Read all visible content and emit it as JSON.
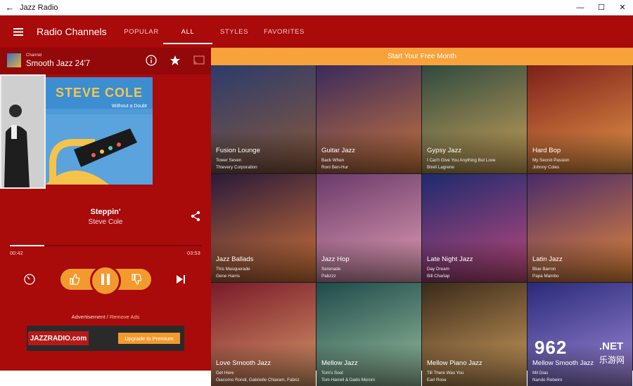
{
  "window": {
    "title": "Jazz Radio",
    "back_glyph": "←",
    "minimize_glyph": "—",
    "maximize_glyph": "☐",
    "close_glyph": "✕"
  },
  "header": {
    "title": "Radio Channels",
    "tabs": [
      {
        "label": "POPULAR",
        "active": false
      },
      {
        "label": "ALL",
        "active": true
      },
      {
        "label": "STYLES",
        "active": false
      },
      {
        "label": "FAVORITES",
        "active": false
      }
    ]
  },
  "player": {
    "channel_caption": "Channel",
    "channel_name": "Smooth Jazz 24'7",
    "album_artist": "STEVE COLE",
    "album_subtitle": "Without a Doubt",
    "song": "Steppin'",
    "artist": "Steve Cole",
    "elapsed": "00:42",
    "duration": "03:53",
    "progress": 0.18
  },
  "ad": {
    "label": "Advertisement",
    "separator": "/",
    "remove_label": "Remove Ads",
    "banner_logo": "JAZZRADIO.com",
    "banner_button": "Upgrade to Premium"
  },
  "promo": "Start Your Free Month",
  "channels": [
    {
      "name": "Fusion Lounge",
      "song": "Tower Seven",
      "artist": "Thievery Corporation",
      "color1": "#2c3b6b",
      "color2": "#8a5a3b"
    },
    {
      "name": "Guitar Jazz",
      "song": "Back When",
      "artist": "Roni Ben-Hur",
      "color1": "#3a2a5c",
      "color2": "#c9763d"
    },
    {
      "name": "Gypsy Jazz",
      "song": "I Can't Give You Anything But Love",
      "artist": "Bireli Lagrene",
      "color1": "#2f4a3f",
      "color2": "#c9a25a"
    },
    {
      "name": "Hard Bop",
      "song": "My Secret Passion",
      "artist": "Johnny Coles",
      "color1": "#7d1f1a",
      "color2": "#e89a4a"
    },
    {
      "name": "Jazz Ballads",
      "song": "This Masquerade",
      "artist": "Gene Harris",
      "color1": "#2a1a3a",
      "color2": "#d0753a"
    },
    {
      "name": "Jazz Hop",
      "song": "Serenade",
      "artist": "Pabzzz",
      "color1": "#6a3a6a",
      "color2": "#e3a0b4"
    },
    {
      "name": "Late Night Jazz",
      "song": "Day Dream",
      "artist": "Bill Charlap",
      "color1": "#1d2a6e",
      "color2": "#c04a7a"
    },
    {
      "name": "Latin Jazz",
      "song": "Blue Barron",
      "artist": "Papa Mambo",
      "color1": "#4a2a6a",
      "color2": "#e58a3a"
    },
    {
      "name": "Love Smooth Jazz",
      "song": "Get Here",
      "artist": "Giacomo Rondi, Gabrielle Chiaram, Fabriz",
      "color1": "#7a1a2a",
      "color2": "#d89a6a"
    },
    {
      "name": "Mellow Jazz",
      "song": "Tom's Soul",
      "artist": "Tom Harrell & Dado Moroni",
      "color1": "#1f4a4a",
      "color2": "#9ac0a0"
    },
    {
      "name": "Mellow Piano Jazz",
      "song": "Till There Was You",
      "artist": "Earl Rose",
      "color1": "#3a2a1a",
      "color2": "#d0a060"
    },
    {
      "name": "Mellow Smooth Jazz",
      "song": "Mil Dias",
      "artist": "Nando Rebeiro",
      "color1": "#2a2a7a",
      "color2": "#a08ad8"
    }
  ],
  "watermark": {
    "main": "962",
    "net": ".NET",
    "cn": "乐游网"
  },
  "colors": {
    "app_red": "#a90a0a",
    "accent_orange": "#f39a2e",
    "promo_orange": "#f8a23c"
  }
}
